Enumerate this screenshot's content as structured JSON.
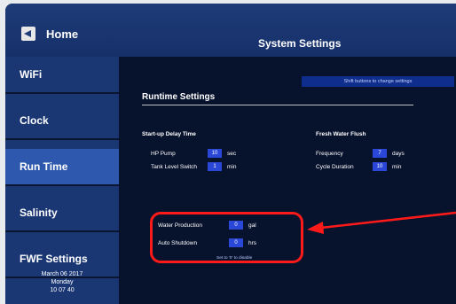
{
  "header": {
    "home_label": "Home",
    "title": "System Settings"
  },
  "sidebar": {
    "items": [
      {
        "label": "WiFi"
      },
      {
        "label": "Clock"
      },
      {
        "label": "Run Time"
      },
      {
        "label": "Salinity"
      },
      {
        "label": "FWF Settings"
      }
    ],
    "clock": {
      "date_line": "March 06 2017",
      "day_line": "Monday",
      "time_line": "10 07 40"
    }
  },
  "main": {
    "hint": "Shift buttons to change settings",
    "section_title": "Runtime Settings",
    "startup": {
      "heading": "Start-up Delay Time",
      "rows": [
        {
          "label": "HP Pump",
          "value": "10",
          "unit": "sec"
        },
        {
          "label": "Tank Level Switch",
          "value": "1",
          "unit": "min"
        }
      ]
    },
    "fresh": {
      "heading": "Fresh Water Flush",
      "rows": [
        {
          "label": "Frequency",
          "value": "7",
          "unit": "days"
        },
        {
          "label": "Cycle Duration",
          "value": "10",
          "unit": "min"
        }
      ]
    },
    "production": {
      "rows": [
        {
          "label": "Water Production",
          "value": "0",
          "unit": "gal"
        },
        {
          "label": "Auto Shutdown",
          "value": "0",
          "unit": "hrs"
        }
      ],
      "note": "Set to '0' to disable"
    }
  },
  "colors": {
    "accent": "#2b47d8",
    "highlight": "#ff1a1a",
    "sidebar": "#1a3774",
    "main_bg": "#07122c"
  }
}
